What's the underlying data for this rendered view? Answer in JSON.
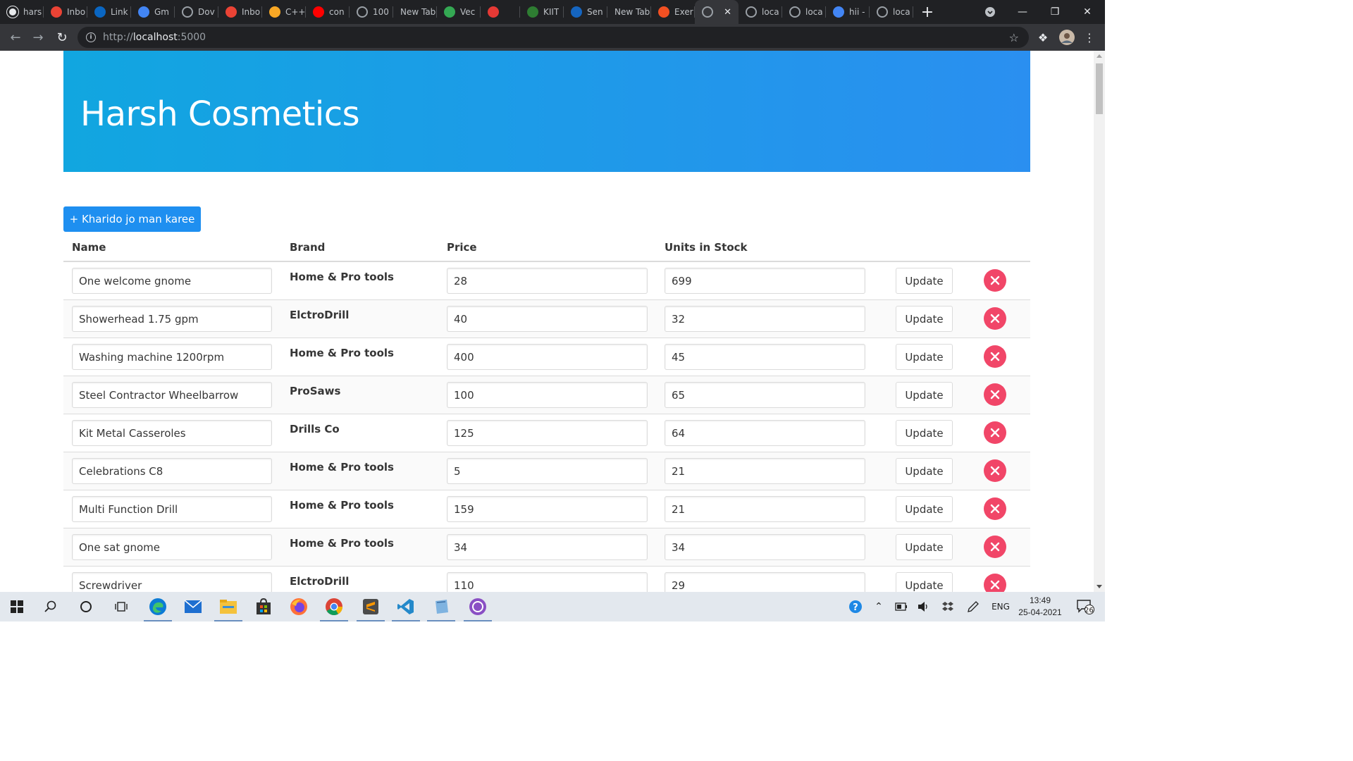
{
  "browser": {
    "tabs": [
      {
        "title": "hars",
        "icon": "github-icon",
        "color": "#ffffff"
      },
      {
        "title": "Inbo",
        "icon": "gmail-icon",
        "color": "#ea4335"
      },
      {
        "title": "Link",
        "icon": "linkedin-icon",
        "color": "#0a66c2"
      },
      {
        "title": "Gm",
        "icon": "google-icon",
        "color": "#4285f4"
      },
      {
        "title": "Dov",
        "icon": "globe-icon",
        "color": "#9aa0a6"
      },
      {
        "title": "Inbo",
        "icon": "gmail-icon",
        "color": "#ea4335"
      },
      {
        "title": "C++",
        "icon": "code-icon",
        "color": "#f9a825"
      },
      {
        "title": "con",
        "icon": "youtube-icon",
        "color": "#ff0000"
      },
      {
        "title": "100",
        "icon": "globe-icon",
        "color": "#9aa0a6"
      },
      {
        "title": "New Tab",
        "icon": "",
        "color": ""
      },
      {
        "title": "Vec",
        "icon": "vector-icon",
        "color": "#34a853"
      },
      {
        "title": "",
        "icon": "calendar-icon",
        "color": "#e53935"
      },
      {
        "title": "KIIT",
        "icon": "kiit-icon",
        "color": "#2e7d32"
      },
      {
        "title": "Sen",
        "icon": "sap-icon",
        "color": "#1565c0"
      },
      {
        "title": "New Tab",
        "icon": "",
        "color": ""
      },
      {
        "title": "Exer",
        "icon": "microsoft-icon",
        "color": "#f25022"
      },
      {
        "title": "",
        "icon": "globe-icon",
        "color": "#9aa0a6"
      },
      {
        "title": "loca",
        "icon": "globe-icon",
        "color": "#9aa0a6"
      },
      {
        "title": "loca",
        "icon": "globe-icon",
        "color": "#9aa0a6"
      },
      {
        "title": "hii -",
        "icon": "google-icon",
        "color": "#4285f4"
      },
      {
        "title": "loca",
        "icon": "globe-icon",
        "color": "#9aa0a6"
      }
    ],
    "active_tab_index": 16,
    "url_prefix": "http://",
    "url_host": "localhost",
    "url_suffix": ":5000"
  },
  "page": {
    "title": "Harsh Cosmetics",
    "add_button_label": "+ Kharido jo man karee",
    "columns": {
      "name": "Name",
      "brand": "Brand",
      "price": "Price",
      "stock": "Units in Stock"
    },
    "update_label": "Update",
    "products": [
      {
        "name": "One welcome gnome",
        "brand": "Home & Pro tools",
        "price": "28",
        "stock": "699"
      },
      {
        "name": "Showerhead 1.75 gpm",
        "brand": "ElctroDrill",
        "price": "40",
        "stock": "32"
      },
      {
        "name": "Washing machine 1200rpm",
        "brand": "Home & Pro tools",
        "price": "400",
        "stock": "45"
      },
      {
        "name": "Steel Contractor Wheelbarrow",
        "brand": "ProSaws",
        "price": "100",
        "stock": "65"
      },
      {
        "name": "Kit Metal Casseroles",
        "brand": "Drills Co",
        "price": "125",
        "stock": "64"
      },
      {
        "name": "Celebrations C8",
        "brand": "Home & Pro tools",
        "price": "5",
        "stock": "21"
      },
      {
        "name": "Multi Function Drill",
        "brand": "Home & Pro tools",
        "price": "159",
        "stock": "21"
      },
      {
        "name": "One sat gnome",
        "brand": "Home & Pro tools",
        "price": "34",
        "stock": "34"
      },
      {
        "name": "Screwdriver",
        "brand": "ElctroDrill",
        "price": "110",
        "stock": "29"
      }
    ]
  },
  "taskbar": {
    "apps": [
      "windows-start-icon",
      "search-icon",
      "cortana-icon",
      "task-view-icon",
      "edge-icon",
      "mail-icon",
      "file-explorer-icon",
      "store-icon",
      "firefox-icon",
      "chrome-icon",
      "sublime-icon",
      "vscode-icon",
      "notepad-icon",
      "github-desktop-icon"
    ],
    "language": "ENG",
    "time": "13:49",
    "date": "25-04-2021",
    "notification_count": "26"
  }
}
